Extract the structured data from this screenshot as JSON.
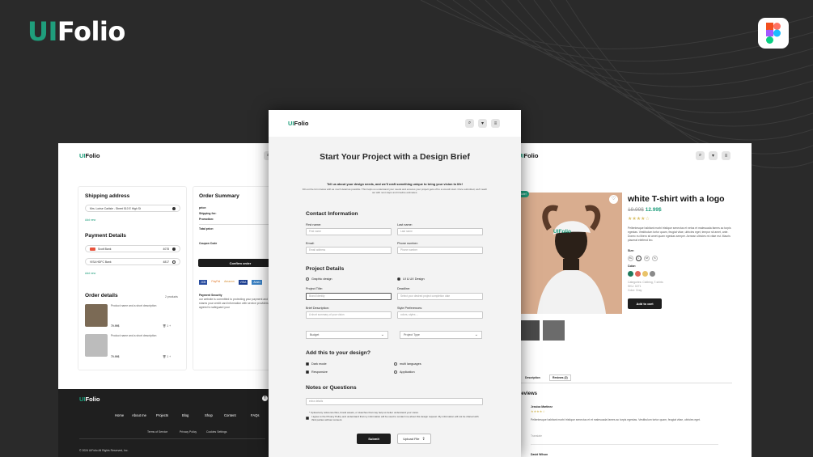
{
  "brand": {
    "ui": "UI",
    "folio": "Folio"
  },
  "figma_icon": "figma-logo-icon",
  "checkout": {
    "logo_ui": "UI",
    "logo_folio": "Folio",
    "shipping_title": "Shipping address",
    "address": "Mrs. Lorise   Carlisle - Street 510 E High St",
    "add_new_1": "Add new",
    "payment_title": "Payment Details",
    "card1_name": "Scott Bank",
    "card1_digits": "4078",
    "card2_name": "VISA   HDFC Bank",
    "card2_digits": "4817",
    "add_new_2": "Add new",
    "order_details_title": "Order details",
    "products_count": "2 products",
    "product_desc_1": "Product name and a short description",
    "product_desc_2": "Product name and a short description",
    "price_1": "70.99$",
    "price_2": "70.99$",
    "qty_1": "1",
    "qty_2": "1",
    "summary_title": "Order Summary",
    "summary_rows": [
      "price:",
      "Shipping fee:",
      "Promotion:"
    ],
    "total_label": "Total price:",
    "coupon_label": "Coupon Code",
    "confirm_button": "Confirm order",
    "payment_logos": [
      "JCB",
      "PayPal",
      "Amazon",
      "VISA",
      "Amex"
    ],
    "security_title": "Payment Security",
    "security_text": "our website is committed to protecting your payment and only shares your credit card information with service providers who agreed to safeguard your",
    "footer_logo_ui": "UI",
    "footer_logo_folio": "Folio",
    "footer_links": [
      "Home",
      "About me",
      "Projects",
      "Blog",
      "Shop",
      "Content",
      "FAQs"
    ],
    "footer_sublinks": [
      "Terms of Service",
      "Privacy Policy",
      "Cookies Settings"
    ],
    "copyright": "© 2024 UIFolio All Rights Reserved, Inc."
  },
  "product": {
    "logo_ui": "UI",
    "logo_folio": "Folio",
    "badge": "Sale!",
    "title": "white T-shirt with a logo",
    "old_price": "19.99$",
    "new_price": "12.99$",
    "rating": 4,
    "description": "Pellentesque habitant morbi tristique senectus et netus et malesuada fames ac turpis egestas. Vestibulum tortor quam, feugiat vitae, ultricies eget, tempor sit amet, ante. Donec eu libero sit amet quam egestas semper. Aenean ultricies mi vitae est. Mauris placerat eleifend leo.",
    "size_label": "Size:",
    "sizes": [
      "XL",
      "L",
      "M",
      "S"
    ],
    "color_label": "Color:",
    "colors": [
      "#1f7a5c",
      "#e0655a",
      "#e9c36a",
      "#8a8a8a"
    ],
    "meta": [
      "Categories: Clothing, T-shirts",
      "SKU: 0271",
      "Color: Gray"
    ],
    "add_to_cart": "Add to cart",
    "tabs": [
      "Description",
      "Reviews (2)"
    ],
    "reviews_title": "Reviews",
    "reviewer_1": "Jessica Martinez",
    "review_text": "Pellentesque habitant morbi tristique senectus et et malesuada fames ac turpis egestas. Vestibulum tortor quam, feugiat vitae, ultricies eget.",
    "review_meta": "Translate",
    "reviewer_2": "David Wilson",
    "image_logo_text": "UIFolio"
  },
  "brief": {
    "logo_ui": "UI",
    "logo_folio": "Folio",
    "title": "Start Your Project with a Design Brief",
    "subtitle_bold": "Tell us about your design needs, and we'll craft something unique to bring your vision to life!",
    "subtitle": "Fill out the form below with as much detail as possible. This helps us understand your needs and ensures your project gets off to a smooth start. Once submitted, we'll reach out with next steps and timeline estimates.",
    "contact_title": "Contact Information",
    "first_name_label": "First name:",
    "first_name_ph": "First name",
    "last_name_label": "Last name:",
    "last_name_ph": "Last name",
    "email_label": "Email:",
    "email_ph": "Email address",
    "phone_label": "Phone number:",
    "phone_ph": "Phone number",
    "project_title": "Project Details",
    "opt_graphic": "Graphic design",
    "opt_uiux": "UI & UX Design",
    "project_title_label": "Project Title:",
    "project_title_ph": "Brand identity",
    "deadline_label": "Deadline:",
    "deadline_ph": "Select your desired project completion date",
    "brief_label": "Brief Description:",
    "brief_ph": "A short summary of your vision",
    "style_label": "Style Preferences:",
    "style_ph": "colors, styles ...",
    "budget": "Budget",
    "project_type": "Project Type",
    "add_title": "Add this to your design?",
    "add_options": [
      "Dark mode",
      "multi languages",
      "Responsive",
      "Application"
    ],
    "notes_title": "Notes or Questions",
    "notes_ph": "extra details",
    "upload_note": "* Upload any reference files, brand assets, or sketches that may help us better understand your vision.",
    "agree_text": "I agree to the Privacy Policy and understand that my information will be used to contact me about this design request. My information will not be shared with third parties without consent.",
    "submit": "Submit",
    "upload": "Upload File"
  }
}
